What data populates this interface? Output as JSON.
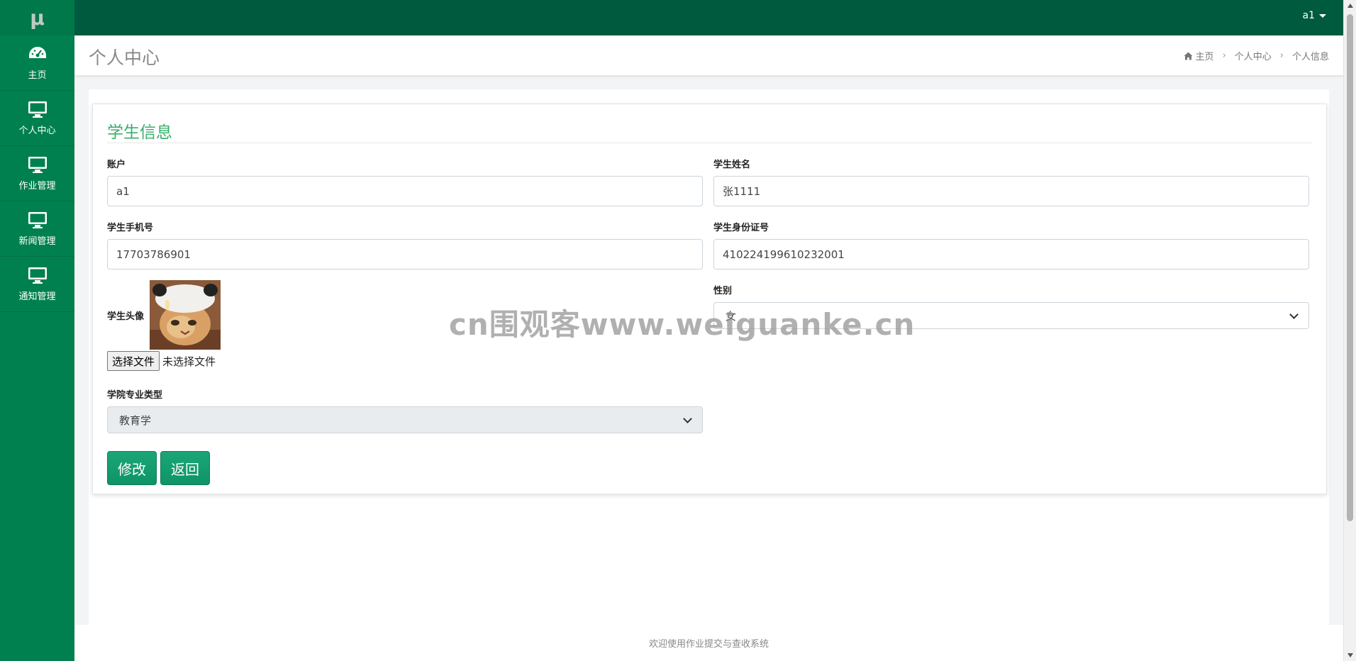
{
  "brand": {
    "logo": "μ"
  },
  "topbar": {
    "user": "a1"
  },
  "sidebar": {
    "items": [
      {
        "label": "主页",
        "icon": "dashboard-icon"
      },
      {
        "label": "个人中心",
        "icon": "monitor-icon"
      },
      {
        "label": "作业管理",
        "icon": "monitor-icon"
      },
      {
        "label": "新闻管理",
        "icon": "monitor-icon"
      },
      {
        "label": "通知管理",
        "icon": "monitor-icon"
      }
    ]
  },
  "header": {
    "title": "个人中心",
    "breadcrumb": [
      "主页",
      "个人中心",
      "个人信息"
    ]
  },
  "form": {
    "title": "学生信息",
    "account": {
      "label": "账户",
      "value": "a1"
    },
    "name": {
      "label": "学生姓名",
      "value": "张1111"
    },
    "phone": {
      "label": "学生手机号",
      "value": "17703786901"
    },
    "id_card": {
      "label": "学生身份证号",
      "value": "410224199610232001"
    },
    "avatar": {
      "label": "学生头像",
      "file_button": "选择文件",
      "file_status": "未选择文件"
    },
    "gender": {
      "label": "性别",
      "value": "女"
    },
    "major": {
      "label": "学院专业类型",
      "value": "教育学"
    },
    "buttons": {
      "modify": "修改",
      "back": "返回"
    }
  },
  "watermark": "cn围观客www.weiguanke.cn",
  "footer": {
    "text": "欢迎使用作业提交与查收系统"
  },
  "colors": {
    "topbar": "#005a3e",
    "sidebar": "#00804f",
    "accent": "#3aae6b",
    "button": "#0e9467"
  }
}
